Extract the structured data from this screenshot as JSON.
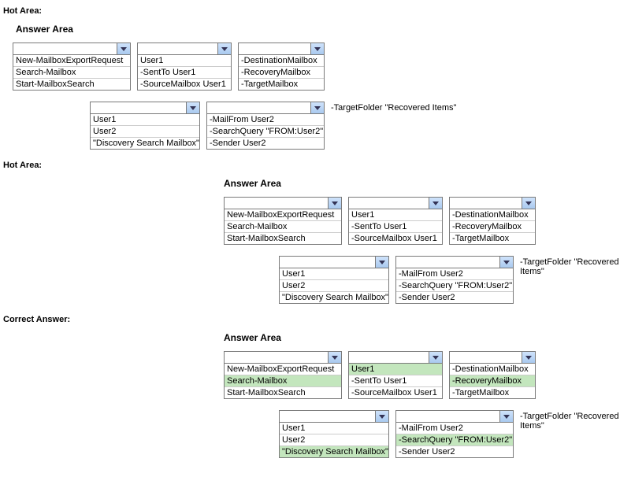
{
  "labels": {
    "hotarea": "Hot Area:",
    "correct": "Correct Answer:",
    "answer_area": "Answer Area"
  },
  "dropdowns": {
    "cmd": [
      "New-MailboxExportRequest",
      "Search-Mailbox",
      "Start-MailboxSearch"
    ],
    "src": [
      "User1",
      "-SentTo User1",
      "-SourceMailbox User1"
    ],
    "dst": [
      "-DestinationMailbox",
      "-RecoveryMailbox",
      "-TargetMailbox"
    ],
    "tgt": [
      "User1",
      "User2",
      "\"Discovery Search Mailbox\""
    ],
    "qry": [
      "-MailFrom User2",
      "-SearchQuery \"FROM:User2\"",
      "-Sender User2"
    ]
  },
  "trailing": "-TargetFolder \"Recovered Items\"",
  "highlights": {
    "cmd": 1,
    "src": 0,
    "dst": 1,
    "tgt": 2,
    "qry": 1
  }
}
